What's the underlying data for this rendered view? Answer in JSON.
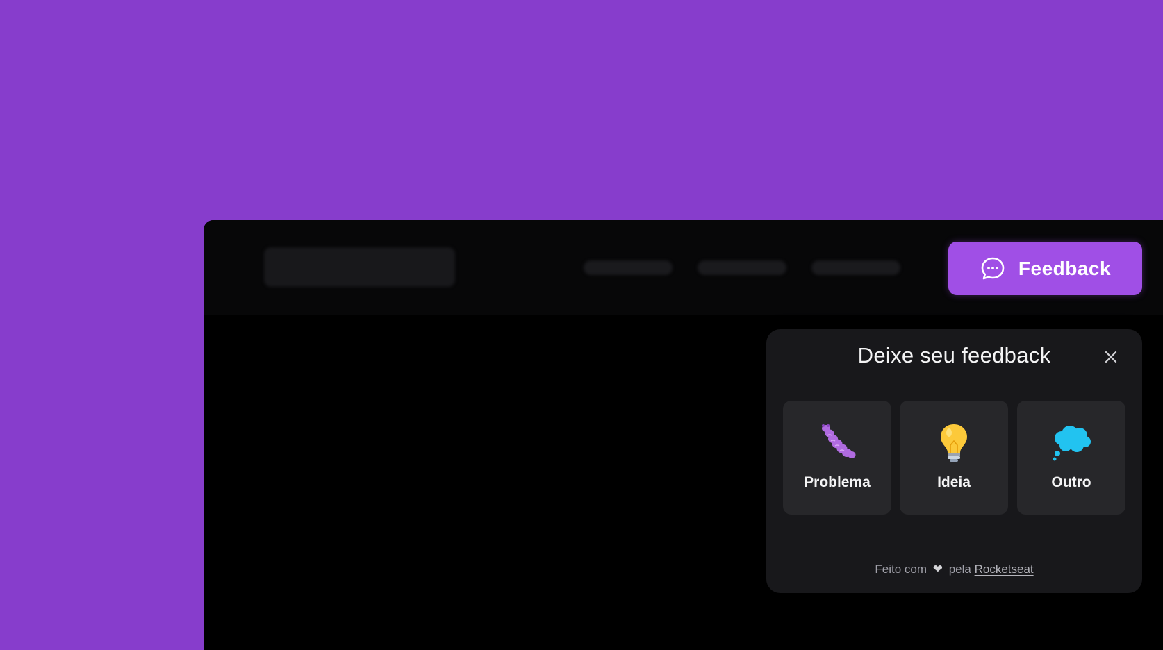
{
  "colors": {
    "background": "#873dcc",
    "brand": "#a04fe6",
    "window": "#000000",
    "widget": "#18181b",
    "option": "#27272a"
  },
  "header": {
    "feedback_button_label": "Feedback",
    "feedback_button_icon": "chat-bubble-icon"
  },
  "widget": {
    "title": "Deixe seu feedback",
    "close_icon": "close-icon",
    "options": [
      {
        "label": "Problema",
        "icon": "bug-icon"
      },
      {
        "label": "Ideia",
        "icon": "lightbulb-icon"
      },
      {
        "label": "Outro",
        "icon": "thought-bubble-icon"
      }
    ],
    "footer": {
      "prefix": "Feito com",
      "heart": "❤",
      "middle": "pela",
      "link": "Rocketseat"
    }
  }
}
